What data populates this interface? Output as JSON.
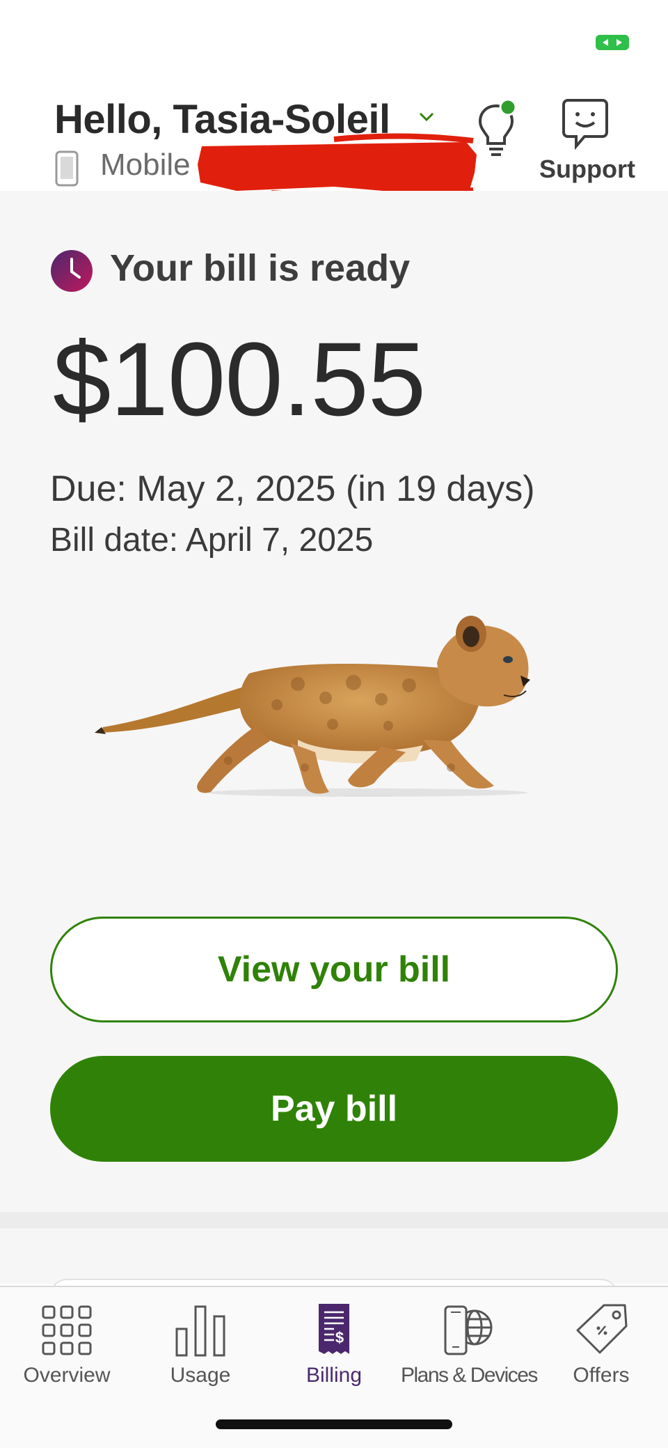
{
  "header": {
    "greeting": "Hello, Tasia-Soleil",
    "account_type": "Mobile",
    "account_number_redacted": true,
    "support_label": "Support",
    "notification_dot_color": "#2f9e2f"
  },
  "bill": {
    "status": "Your bill is ready",
    "amount": "$100.55",
    "due": "Due: May 2, 2025 (in 19 days)",
    "bill_date": "Bill date: April 7, 2025",
    "view_label": "View your bill",
    "pay_label": "Pay bill"
  },
  "tabs": [
    {
      "label": "Overview",
      "icon": "grid-icon",
      "active": false
    },
    {
      "label": "Usage",
      "icon": "bar-chart-icon",
      "active": false
    },
    {
      "label": "Billing",
      "icon": "bill-icon",
      "active": true
    },
    {
      "label": "Plans & Devices",
      "icon": "device-globe-icon",
      "active": false
    },
    {
      "label": "Offers",
      "icon": "tag-icon",
      "active": false
    }
  ],
  "colors": {
    "primary_green": "#2f8207",
    "active_purple": "#4b286d",
    "redaction_red": "#e0200c"
  }
}
